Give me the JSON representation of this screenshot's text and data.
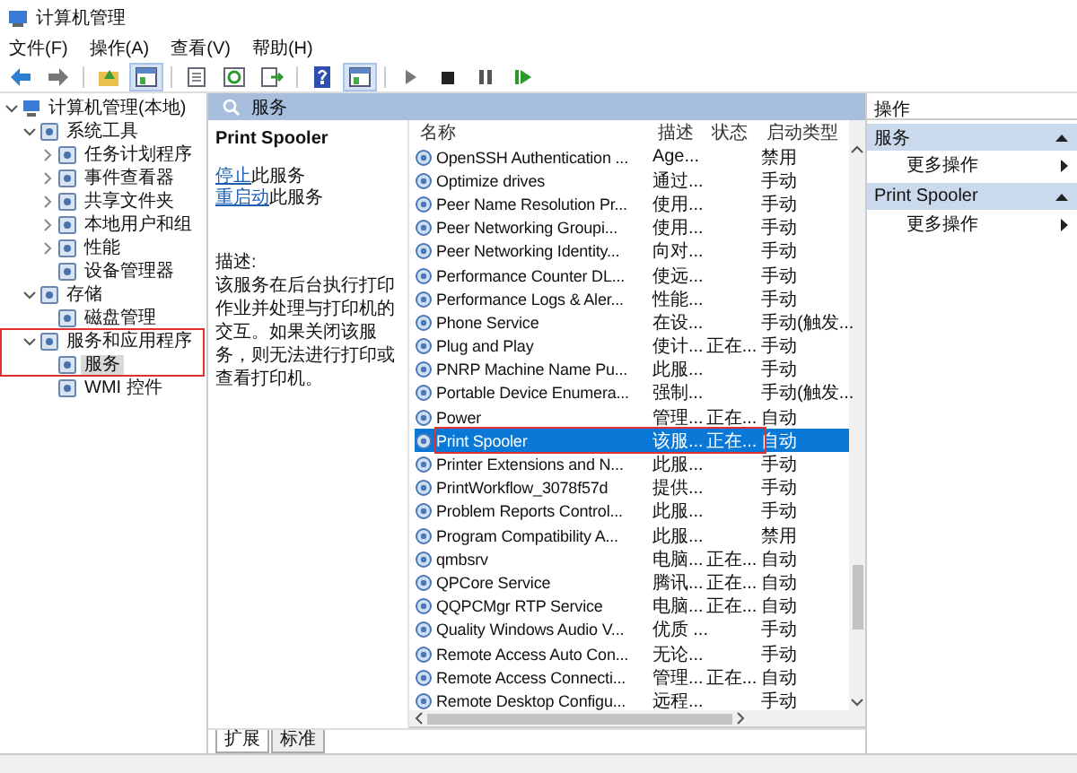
{
  "window": {
    "title": "计算机管理"
  },
  "menu": [
    "文件(F)",
    "操作(A)",
    "查看(V)",
    "帮助(H)"
  ],
  "toolbar": [
    {
      "kind": "back"
    },
    {
      "kind": "forward"
    },
    {
      "kind": "sep"
    },
    {
      "kind": "folder"
    },
    {
      "kind": "pane",
      "selected": true
    },
    {
      "kind": "sep"
    },
    {
      "kind": "properties"
    },
    {
      "kind": "refresh"
    },
    {
      "kind": "export"
    },
    {
      "kind": "sep"
    },
    {
      "kind": "help"
    },
    {
      "kind": "pane",
      "selected": true
    },
    {
      "kind": "sep"
    },
    {
      "kind": "play"
    },
    {
      "kind": "stop"
    },
    {
      "kind": "pause"
    },
    {
      "kind": "resume"
    }
  ],
  "tree": [
    {
      "label": "计算机管理(本地)",
      "expanded": true,
      "selected": false,
      "children": [
        {
          "label": "系统工具",
          "expanded": true,
          "selected": false,
          "children": [
            {
              "label": "任务计划程序",
              "expanded": false,
              "selected": false
            },
            {
              "label": "事件查看器",
              "expanded": false,
              "selected": false
            },
            {
              "label": "共享文件夹",
              "expanded": false,
              "selected": false
            },
            {
              "label": "本地用户和组",
              "expanded": false,
              "selected": false
            },
            {
              "label": "性能",
              "expanded": false,
              "selected": false
            },
            {
              "label": "设备管理器",
              "selected": false
            }
          ]
        },
        {
          "label": "存储",
          "expanded": true,
          "selected": false,
          "children": [
            {
              "label": "磁盘管理",
              "selected": false
            }
          ]
        },
        {
          "label": "服务和应用程序",
          "expanded": true,
          "selected": false,
          "highlighted": true,
          "children": [
            {
              "label": "服务",
              "selected": true
            },
            {
              "label": "WMI 控件",
              "selected": false
            }
          ]
        }
      ]
    }
  ],
  "panel_title": "服务",
  "detail": {
    "name": "Print Spooler",
    "actions": [
      {
        "link": "停止",
        "text": "此服务"
      },
      {
        "link": "重启动",
        "text": "此服务"
      }
    ],
    "description_label": "描述:",
    "description": "该服务在后台执行打印作业并处理与打印机的交互。如果关闭该服务，则无法进行打印或查看打印机。"
  },
  "table": {
    "columns": [
      "名称",
      "描述",
      "状态",
      "启动类型"
    ],
    "rows": [
      {
        "cells": [
          "OpenSSH Authentication ...",
          "Age...",
          "",
          "禁用"
        ],
        "selected": false,
        "highlighted": false
      },
      {
        "cells": [
          "Optimize drives",
          "通过...",
          "",
          "手动"
        ],
        "selected": false,
        "highlighted": false
      },
      {
        "cells": [
          "Peer Name Resolution Pr...",
          "使用...",
          "",
          "手动"
        ],
        "selected": false,
        "highlighted": false
      },
      {
        "cells": [
          "Peer Networking Groupi...",
          "使用...",
          "",
          "手动"
        ],
        "selected": false,
        "highlighted": false
      },
      {
        "cells": [
          "Peer Networking Identity...",
          "向对...",
          "",
          "手动"
        ],
        "selected": false,
        "highlighted": false
      },
      {
        "cells": [
          "Performance Counter DL...",
          "使远...",
          "",
          "手动"
        ],
        "selected": false,
        "highlighted": false
      },
      {
        "cells": [
          "Performance Logs & Aler...",
          "性能...",
          "",
          "手动"
        ],
        "selected": false,
        "highlighted": false
      },
      {
        "cells": [
          "Phone Service",
          "在设...",
          "",
          "手动(触发..."
        ],
        "selected": false,
        "highlighted": false
      },
      {
        "cells": [
          "Plug and Play",
          "使计...",
          "正在...",
          "手动"
        ],
        "selected": false,
        "highlighted": false
      },
      {
        "cells": [
          "PNRP Machine Name Pu...",
          "此服...",
          "",
          "手动"
        ],
        "selected": false,
        "highlighted": false
      },
      {
        "cells": [
          "Portable Device Enumera...",
          "强制...",
          "",
          "手动(触发..."
        ],
        "selected": false,
        "highlighted": false
      },
      {
        "cells": [
          "Power",
          "管理...",
          "正在...",
          "自动"
        ],
        "selected": false,
        "highlighted": false
      },
      {
        "cells": [
          "Print Spooler",
          "该服...",
          "正在...",
          "自动"
        ],
        "selected": true,
        "highlighted": true
      },
      {
        "cells": [
          "Printer Extensions and N...",
          "此服...",
          "",
          "手动"
        ],
        "selected": false,
        "highlighted": false
      },
      {
        "cells": [
          "PrintWorkflow_3078f57d",
          "提供...",
          "",
          "手动"
        ],
        "selected": false,
        "highlighted": false
      },
      {
        "cells": [
          "Problem Reports Control...",
          "此服...",
          "",
          "手动"
        ],
        "selected": false,
        "highlighted": false
      },
      {
        "cells": [
          "Program Compatibility A...",
          "此服...",
          "",
          "禁用"
        ],
        "selected": false,
        "highlighted": false
      },
      {
        "cells": [
          "qmbsrv",
          "电脑...",
          "正在...",
          "自动"
        ],
        "selected": false,
        "highlighted": false
      },
      {
        "cells": [
          "QPCore Service",
          "腾讯...",
          "正在...",
          "自动"
        ],
        "selected": false,
        "highlighted": false
      },
      {
        "cells": [
          "QQPCMgr RTP Service",
          "电脑...",
          "正在...",
          "自动"
        ],
        "selected": false,
        "highlighted": false
      },
      {
        "cells": [
          "Quality Windows Audio V...",
          "优质 ...",
          "",
          "手动"
        ],
        "selected": false,
        "highlighted": false
      },
      {
        "cells": [
          "Remote Access Auto Con...",
          "无论...",
          "",
          "手动"
        ],
        "selected": false,
        "highlighted": false
      },
      {
        "cells": [
          "Remote Access Connecti...",
          "管理...",
          "正在...",
          "自动"
        ],
        "selected": false,
        "highlighted": false
      },
      {
        "cells": [
          "Remote Desktop Configu...",
          "远程...",
          "",
          "手动"
        ],
        "selected": false,
        "highlighted": false
      }
    ]
  },
  "bottom_tabs": [
    {
      "label": "扩展",
      "selected": true
    },
    {
      "label": "标准",
      "selected": false
    }
  ],
  "actions_pane": {
    "title": "操作",
    "sections": [
      {
        "title": "服务",
        "items": [
          "更多操作"
        ]
      },
      {
        "title": "Print Spooler",
        "items": [
          "更多操作"
        ]
      }
    ]
  }
}
